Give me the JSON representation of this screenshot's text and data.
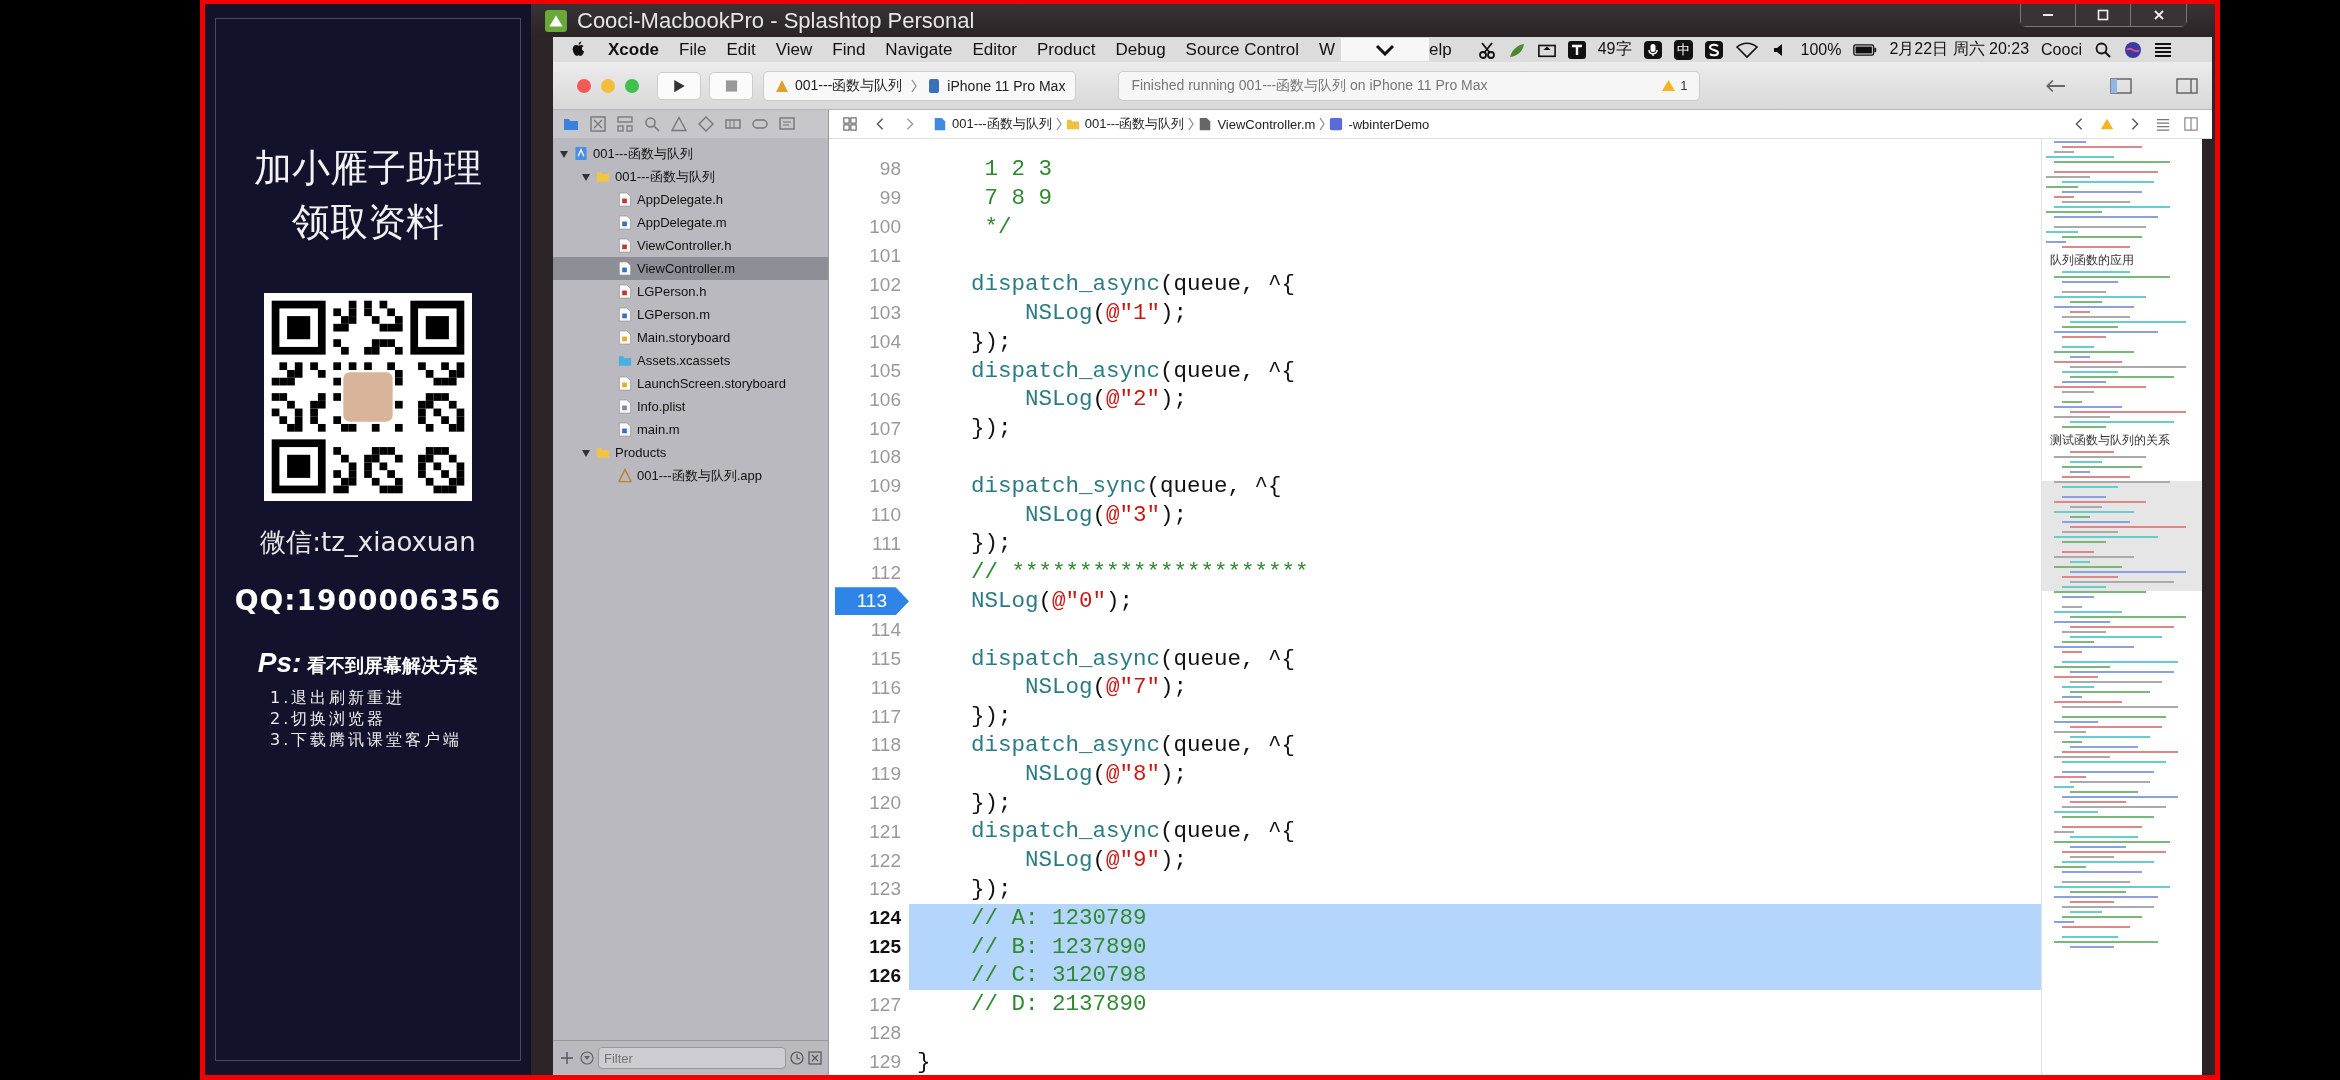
{
  "window": {
    "title": "Cooci-MacbookPro - Splashtop Personal"
  },
  "promo": {
    "heading": [
      "加小雁子助理",
      "领取资料"
    ],
    "wechat": "微信:tz_xiaoxuan",
    "qq": "QQ:1900006356",
    "ps_label": "Ps:",
    "ps_title": "看不到屏幕解决方案",
    "steps": [
      "1.退出刷新重进",
      "2.切换浏览器",
      "3.下载腾讯课堂客户端"
    ]
  },
  "menu_bar": {
    "app": "Xcode",
    "items": [
      "File",
      "Edit",
      "View",
      "Find",
      "Navigate",
      "Editor",
      "Product",
      "Debug",
      "Source Control",
      "W"
    ],
    "items_after_overlay": [
      "elp"
    ],
    "status": {
      "word_count": "49字",
      "ime_mode": "中",
      "battery": "100%",
      "clock": "2月22日 周六 20:23",
      "user": "Cooci"
    }
  },
  "toolbar": {
    "scheme": "001---函数与队列",
    "device": "iPhone 11 Pro Max",
    "activity": "Finished running 001---函数与队列 on iPhone 11 Pro Max",
    "warnings": "1"
  },
  "jump_bar": {
    "crumbs": [
      {
        "kind": "project",
        "label": "001---函数与队列"
      },
      {
        "kind": "folder",
        "label": "001---函数与队列"
      },
      {
        "kind": "file",
        "label": "ViewController.m"
      },
      {
        "kind": "method",
        "label": "-wbinterDemo"
      }
    ]
  },
  "navigator": {
    "tree": [
      {
        "kind": "project",
        "label": "001---函数与队列",
        "expanded": true,
        "selected": false,
        "children": [
          {
            "kind": "folder",
            "label": "001---函数与队列",
            "expanded": true,
            "selected": false,
            "children": [
              {
                "kind": "h",
                "label": "AppDelegate.h",
                "selected": false
              },
              {
                "kind": "m",
                "label": "AppDelegate.m",
                "selected": false
              },
              {
                "kind": "h",
                "label": "ViewController.h",
                "selected": false
              },
              {
                "kind": "m",
                "label": "ViewController.m",
                "selected": true
              },
              {
                "kind": "h",
                "label": "LGPerson.h",
                "selected": false
              },
              {
                "kind": "m",
                "label": "LGPerson.m",
                "selected": false
              },
              {
                "kind": "storyboard",
                "label": "Main.storyboard",
                "selected": false
              },
              {
                "kind": "assets",
                "label": "Assets.xcassets",
                "selected": false
              },
              {
                "kind": "storyboard",
                "label": "LaunchScreen.storyboard",
                "selected": false
              },
              {
                "kind": "plist",
                "label": "Info.plist",
                "selected": false
              },
              {
                "kind": "m",
                "label": "main.m",
                "selected": false
              }
            ]
          },
          {
            "kind": "folder",
            "label": "Products",
            "expanded": true,
            "selected": false,
            "children": [
              {
                "kind": "app",
                "label": "001---函数与队列.app",
                "selected": false
              }
            ]
          }
        ]
      }
    ],
    "filter": {
      "placeholder": "Filter"
    }
  },
  "code": {
    "lines": [
      {
        "number": "98",
        "selected": false,
        "breakpoint": false,
        "tokens": [
          {
            "text": "     1 2 3",
            "kind": "comment"
          }
        ]
      },
      {
        "number": "99",
        "selected": false,
        "breakpoint": false,
        "tokens": [
          {
            "text": "     7 8 9",
            "kind": "comment"
          }
        ]
      },
      {
        "number": "100",
        "selected": false,
        "breakpoint": false,
        "tokens": [
          {
            "text": "     */",
            "kind": "comment"
          }
        ]
      },
      {
        "number": "101",
        "selected": false,
        "breakpoint": false
      },
      {
        "number": "102",
        "selected": false,
        "breakpoint": false,
        "tokens": [
          {
            "text": "    dispatch_async",
            "kind": "func"
          },
          {
            "text": "(queue, ^{",
            "kind": "plain"
          }
        ]
      },
      {
        "number": "103",
        "selected": false,
        "breakpoint": false,
        "tokens": [
          {
            "text": "        NSLog",
            "kind": "func"
          },
          {
            "text": "(",
            "kind": "plain"
          },
          {
            "text": "@\"1\"",
            "kind": "string"
          },
          {
            "text": ");",
            "kind": "plain"
          }
        ]
      },
      {
        "number": "104",
        "selected": false,
        "breakpoint": false,
        "tokens": [
          {
            "text": "    });",
            "kind": "plain"
          }
        ]
      },
      {
        "number": "105",
        "selected": false,
        "breakpoint": false,
        "tokens": [
          {
            "text": "    dispatch_async",
            "kind": "func"
          },
          {
            "text": "(queue, ^{",
            "kind": "plain"
          }
        ]
      },
      {
        "number": "106",
        "selected": false,
        "breakpoint": false,
        "tokens": [
          {
            "text": "        NSLog",
            "kind": "func"
          },
          {
            "text": "(",
            "kind": "plain"
          },
          {
            "text": "@\"2\"",
            "kind": "string"
          },
          {
            "text": ");",
            "kind": "plain"
          }
        ]
      },
      {
        "number": "107",
        "selected": false,
        "breakpoint": false,
        "tokens": [
          {
            "text": "    });",
            "kind": "plain"
          }
        ]
      },
      {
        "number": "108",
        "selected": false,
        "breakpoint": false
      },
      {
        "number": "109",
        "selected": false,
        "breakpoint": false,
        "tokens": [
          {
            "text": "    dispatch_sync",
            "kind": "func"
          },
          {
            "text": "(queue, ^{",
            "kind": "plain"
          }
        ]
      },
      {
        "number": "110",
        "selected": false,
        "breakpoint": false,
        "tokens": [
          {
            "text": "        NSLog",
            "kind": "func"
          },
          {
            "text": "(",
            "kind": "plain"
          },
          {
            "text": "@\"3\"",
            "kind": "string"
          },
          {
            "text": ");",
            "kind": "plain"
          }
        ]
      },
      {
        "number": "111",
        "selected": false,
        "breakpoint": false,
        "tokens": [
          {
            "text": "    });",
            "kind": "plain"
          }
        ]
      },
      {
        "number": "112",
        "selected": false,
        "breakpoint": false,
        "tokens": [
          {
            "text": "    // **********************",
            "kind": "comment"
          }
        ]
      },
      {
        "number": "113",
        "selected": false,
        "breakpoint": true,
        "tokens": [
          {
            "text": "    NSLog",
            "kind": "func"
          },
          {
            "text": "(",
            "kind": "plain"
          },
          {
            "text": "@\"0\"",
            "kind": "string"
          },
          {
            "text": ");",
            "kind": "plain"
          }
        ]
      },
      {
        "number": "114",
        "selected": false,
        "breakpoint": false
      },
      {
        "number": "115",
        "selected": false,
        "breakpoint": false,
        "tokens": [
          {
            "text": "    dispatch_async",
            "kind": "func"
          },
          {
            "text": "(queue, ^{",
            "kind": "plain"
          }
        ]
      },
      {
        "number": "116",
        "selected": false,
        "breakpoint": false,
        "tokens": [
          {
            "text": "        NSLog",
            "kind": "func"
          },
          {
            "text": "(",
            "kind": "plain"
          },
          {
            "text": "@\"7\"",
            "kind": "string"
          },
          {
            "text": ");",
            "kind": "plain"
          }
        ]
      },
      {
        "number": "117",
        "selected": false,
        "breakpoint": false,
        "tokens": [
          {
            "text": "    });",
            "kind": "plain"
          }
        ]
      },
      {
        "number": "118",
        "selected": false,
        "breakpoint": false,
        "tokens": [
          {
            "text": "    dispatch_async",
            "kind": "func"
          },
          {
            "text": "(queue, ^{",
            "kind": "plain"
          }
        ]
      },
      {
        "number": "119",
        "selected": false,
        "breakpoint": false,
        "tokens": [
          {
            "text": "        NSLog",
            "kind": "func"
          },
          {
            "text": "(",
            "kind": "plain"
          },
          {
            "text": "@\"8\"",
            "kind": "string"
          },
          {
            "text": ");",
            "kind": "plain"
          }
        ]
      },
      {
        "number": "120",
        "selected": false,
        "breakpoint": false,
        "tokens": [
          {
            "text": "    });",
            "kind": "plain"
          }
        ]
      },
      {
        "number": "121",
        "selected": false,
        "breakpoint": false,
        "tokens": [
          {
            "text": "    dispatch_async",
            "kind": "func"
          },
          {
            "text": "(queue, ^{",
            "kind": "plain"
          }
        ]
      },
      {
        "number": "122",
        "selected": false,
        "breakpoint": false,
        "tokens": [
          {
            "text": "        NSLog",
            "kind": "func"
          },
          {
            "text": "(",
            "kind": "plain"
          },
          {
            "text": "@\"9\"",
            "kind": "string"
          },
          {
            "text": ");",
            "kind": "plain"
          }
        ]
      },
      {
        "number": "123",
        "selected": false,
        "breakpoint": false,
        "tokens": [
          {
            "text": "    });",
            "kind": "plain"
          }
        ]
      },
      {
        "number": "124",
        "selected": true,
        "breakpoint": false,
        "tokens": [
          {
            "text": "    // A: 1230789",
            "kind": "comment"
          }
        ]
      },
      {
        "number": "125",
        "selected": true,
        "breakpoint": false,
        "tokens": [
          {
            "text": "    // B: 1237890",
            "kind": "comment"
          }
        ]
      },
      {
        "number": "126",
        "selected": true,
        "breakpoint": false,
        "tokens": [
          {
            "text": "    // C: 3120798",
            "kind": "comment"
          }
        ]
      },
      {
        "number": "127",
        "selected": false,
        "breakpoint": false,
        "tokens": [
          {
            "text": "    // D: 2137890",
            "kind": "comment"
          }
        ]
      },
      {
        "number": "128",
        "selected": false,
        "breakpoint": false
      },
      {
        "number": "129",
        "selected": false,
        "breakpoint": false,
        "tokens": [
          {
            "text": "}",
            "kind": "plain"
          }
        ]
      }
    ]
  },
  "minimap": {
    "headings": [
      "队列函数的应用",
      "测试函数与队列的关系"
    ]
  }
}
